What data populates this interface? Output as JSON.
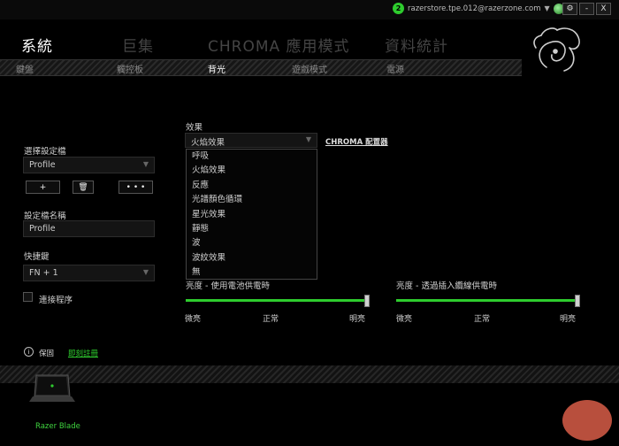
{
  "window": {
    "account_badge": "2",
    "email": "razerstore.tpe.012@razerzone.com",
    "settings_label": "⚙",
    "minimize_label": "-",
    "close_label": "X"
  },
  "main_tabs": [
    {
      "label": "系統",
      "active": true
    },
    {
      "label": "巨集",
      "active": false
    },
    {
      "label": "CHROMA 應用模式",
      "active": false
    },
    {
      "label": "資料統計",
      "active": false
    }
  ],
  "sub_tabs": [
    {
      "label": "鍵盤",
      "active": false
    },
    {
      "label": "觸控板",
      "active": false
    },
    {
      "label": "背光",
      "active": true
    },
    {
      "label": "遊戲模式",
      "active": false
    },
    {
      "label": "電源",
      "active": false
    }
  ],
  "profile": {
    "select_label": "選擇設定檔",
    "selected": "Profile",
    "buttons": [
      "+",
      "🗑",
      "• • •"
    ],
    "name_label": "設定檔名稱",
    "name_value": "Profile",
    "hotkey_label": "快捷鍵",
    "hotkey_value": "FN + 1",
    "link_program_label": "連接程序"
  },
  "effects": {
    "label": "效果",
    "selected": "火焰效果",
    "chroma_link": "CHROMA 配置器",
    "options": [
      "呼吸",
      "火焰效果",
      "反應",
      "光譜顏色循環",
      "星光效果",
      "靜態",
      "波",
      "波紋效果",
      "無"
    ]
  },
  "brightness_battery": {
    "label": "亮度 - 使用電池供電時",
    "min": "微亮",
    "mid": "正常",
    "max": "明亮",
    "level": 1.0
  },
  "brightness_ac": {
    "label": "亮度 - 透過插入纜線供電時",
    "min": "微亮",
    "mid": "正常",
    "max": "明亮",
    "level": 1.0
  },
  "footer": {
    "help_text": "保固",
    "help_link": "即刻註冊",
    "device_name": "Razer Blade"
  },
  "colors": {
    "accent": "#2ecc2e",
    "background": "#000000"
  }
}
